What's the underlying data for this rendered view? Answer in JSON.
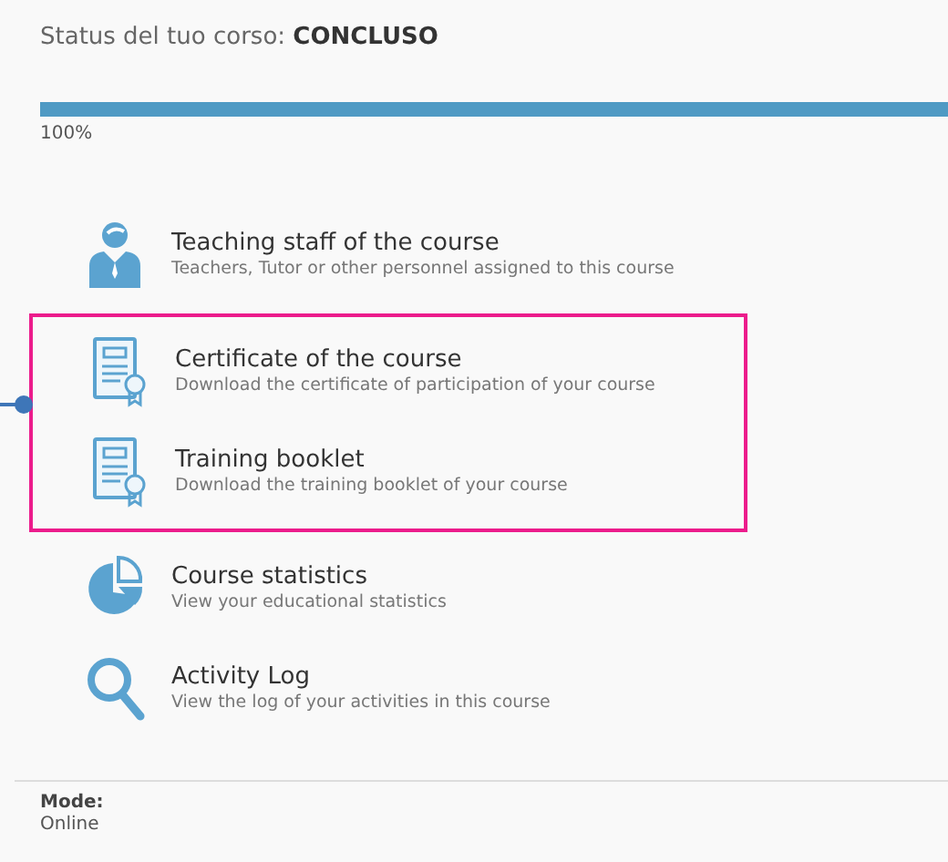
{
  "status": {
    "label": "Status del tuo corso:",
    "value": "CONCLUSO"
  },
  "progress": {
    "level": 1,
    "reading": "100%"
  },
  "items": [
    {
      "kind": "person",
      "title": "Teaching staff of the course",
      "description": "Teachers, Tutor or other personnel assigned to this course",
      "highlighted": false
    },
    {
      "kind": "certificate",
      "title": "Certificate of the course",
      "description": "Download the certificate of participation of your course",
      "highlighted": true
    },
    {
      "kind": "certificate",
      "title": "Training booklet",
      "description": "Download the training booklet of your course",
      "highlighted": true
    },
    {
      "kind": "pie",
      "title": "Course statistics",
      "description": "View your educational statistics",
      "highlighted": false
    },
    {
      "kind": "search",
      "title": "Activity Log",
      "description": "View the log of your activities in this course",
      "highlighted": false
    }
  ],
  "details": [
    {
      "label": "Mode:",
      "value": "Online"
    }
  ]
}
